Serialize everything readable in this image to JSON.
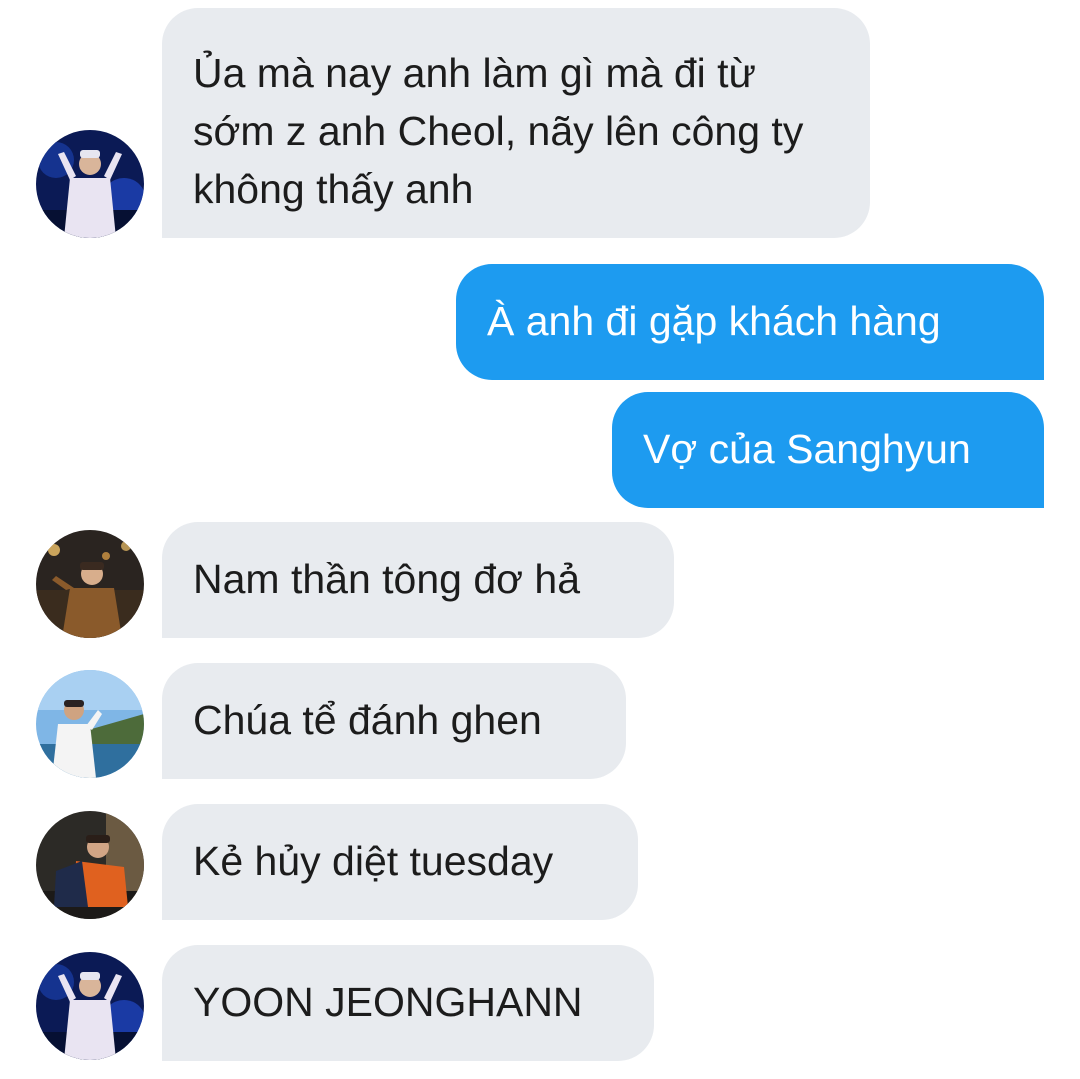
{
  "conversation": {
    "messages": [
      {
        "direction": "incoming",
        "text": "Ủa mà nay anh làm gì mà đi từ sớm z anh Cheol, nãy lên công ty không thấy anh",
        "avatar": "avatar-night-blue"
      },
      {
        "direction": "outgoing",
        "text": "À anh đi gặp khách hàng"
      },
      {
        "direction": "outgoing",
        "text": "Vợ của Sanghyun"
      },
      {
        "direction": "incoming",
        "text": "Nam thần tông đơ hả",
        "avatar": "avatar-night-street"
      },
      {
        "direction": "incoming",
        "text": "Chúa tể đánh ghen",
        "avatar": "avatar-sea-sky"
      },
      {
        "direction": "incoming",
        "text": "Kẻ hủy diệt tuesday",
        "avatar": "avatar-orange-shirt"
      },
      {
        "direction": "incoming",
        "text": "YOON JEONGHANN",
        "avatar": "avatar-night-blue"
      }
    ]
  },
  "colors": {
    "incoming_bubble": "#e8ebef",
    "outgoing_bubble": "#1d9bf0",
    "incoming_text": "#1c1c1c",
    "outgoing_text": "#ffffff",
    "background": "#ffffff"
  }
}
